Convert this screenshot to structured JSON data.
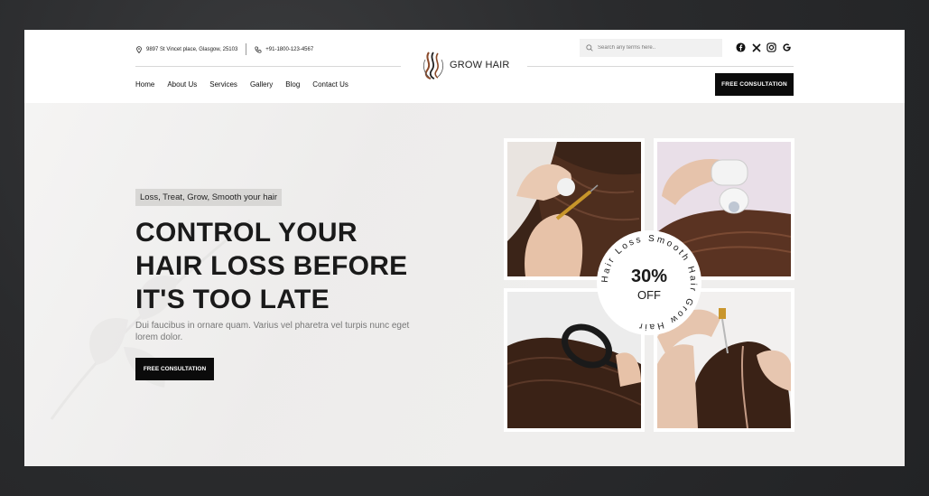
{
  "header": {
    "address": "9897 St Vincet place, Glasgow, 25103",
    "phone": "+91-1800-123-4567",
    "logo_text": "GROW HAIR",
    "search_placeholder": "Search any terms here..",
    "social_icons": [
      "facebook-icon",
      "x-icon",
      "instagram-icon",
      "google-icon"
    ],
    "nav": [
      "Home",
      "About Us",
      "Services",
      "Gallery",
      "Blog",
      "Contact Us"
    ],
    "cta": "FREE CONSULTATION"
  },
  "hero": {
    "tag": "Loss, Treat, Grow, Smooth your hair",
    "headline": [
      "CONTROL YOUR",
      "HAIR LOSS BEFORE",
      "IT'S TOO LATE"
    ],
    "description": "Dui faucibus in ornare quam. Varius vel pharetra vel turpis nunc eget lorem dolor.",
    "cta": "FREE CONSULTATION"
  },
  "badge": {
    "percent": "30%",
    "off": "OFF",
    "ring_text": "Hair Loss  Smooth  Hair  Grow  Hair"
  },
  "colors": {
    "dark": "#0b0b0b",
    "hero_bg": "#efeeed",
    "logo_accent": "#8a4a2a"
  }
}
